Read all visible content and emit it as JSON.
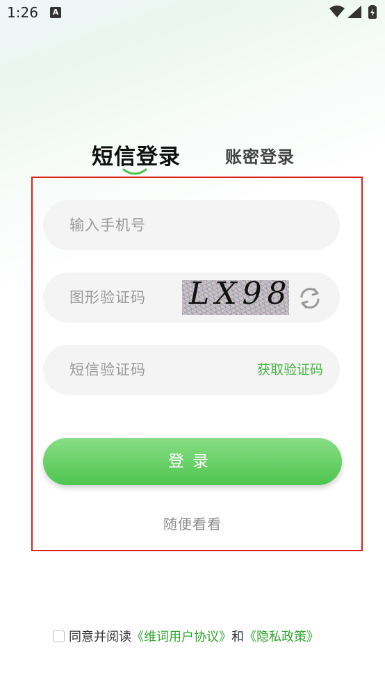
{
  "status_bar": {
    "time": "1:26",
    "notification_icon": "A"
  },
  "tabs": {
    "sms_login": "短信登录",
    "password_login": "账密登录"
  },
  "form": {
    "phone_placeholder": "输入手机号",
    "captcha_placeholder": "图形验证码",
    "captcha_text": "LX98",
    "sms_code_placeholder": "短信验证码",
    "get_code_label": "获取验证码",
    "login_label": "登录",
    "browse_label": "随便看看"
  },
  "agreement": {
    "prefix": "同意并阅读",
    "user_agreement": "《维词用户协议》",
    "and": "和",
    "privacy_policy": "《隐私政策》"
  },
  "colors": {
    "accent": "#4ec54e",
    "link": "#2fa52f",
    "highlight_frame": "#d9201c"
  }
}
